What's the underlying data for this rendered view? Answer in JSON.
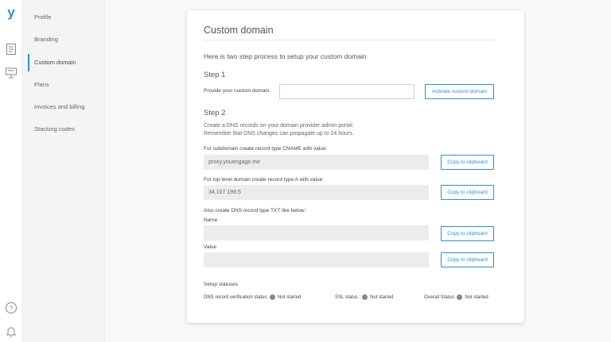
{
  "rail": {
    "logo": "y",
    "icons": [
      "document-list-icon",
      "presentation-icon",
      "help-icon",
      "bell-icon"
    ]
  },
  "sidebar": {
    "items": [
      {
        "label": "Profile"
      },
      {
        "label": "Branding"
      },
      {
        "label": "Custom domain",
        "active": true
      },
      {
        "label": "Plans"
      },
      {
        "label": "Invoices and billing"
      },
      {
        "label": "Stacking codes"
      }
    ]
  },
  "card": {
    "title": "Custom domain",
    "intro": "Here is two step process to setup your custom domain",
    "step1": {
      "heading": "Step 1",
      "label": "Provide your custom domain:",
      "input_value": "",
      "button": "Activate custom domain"
    },
    "step2": {
      "heading": "Step 2",
      "desc_line1": "Create a DNS records on your domain provider admin portal.",
      "desc_line2": "Remember that DNS changes can propagate up to 24 hours.",
      "cname_label": "For subdomain create record type CNAME with value:",
      "cname_value": "proxy.youengage.me",
      "a_label": "For top level domain create record type A with value:",
      "a_value": "34.107.199.5",
      "txt_label": "Also create DNS record type TXT like below:",
      "name_label": "Name",
      "name_value": "",
      "value_label": "Value",
      "value_value": "",
      "copy_button": "Copy to clipboard"
    },
    "statuses": {
      "heading": "Setup statuses",
      "dns_label": "DNS record verification status:",
      "dns_value": "Not started",
      "ssl_label": "SSL status :",
      "ssl_value": "Not started",
      "overall_label": "Overall Status:",
      "overall_value": "Not started",
      "dot_color": "#888888"
    }
  },
  "colors": {
    "accent": "#2e8fd6"
  }
}
